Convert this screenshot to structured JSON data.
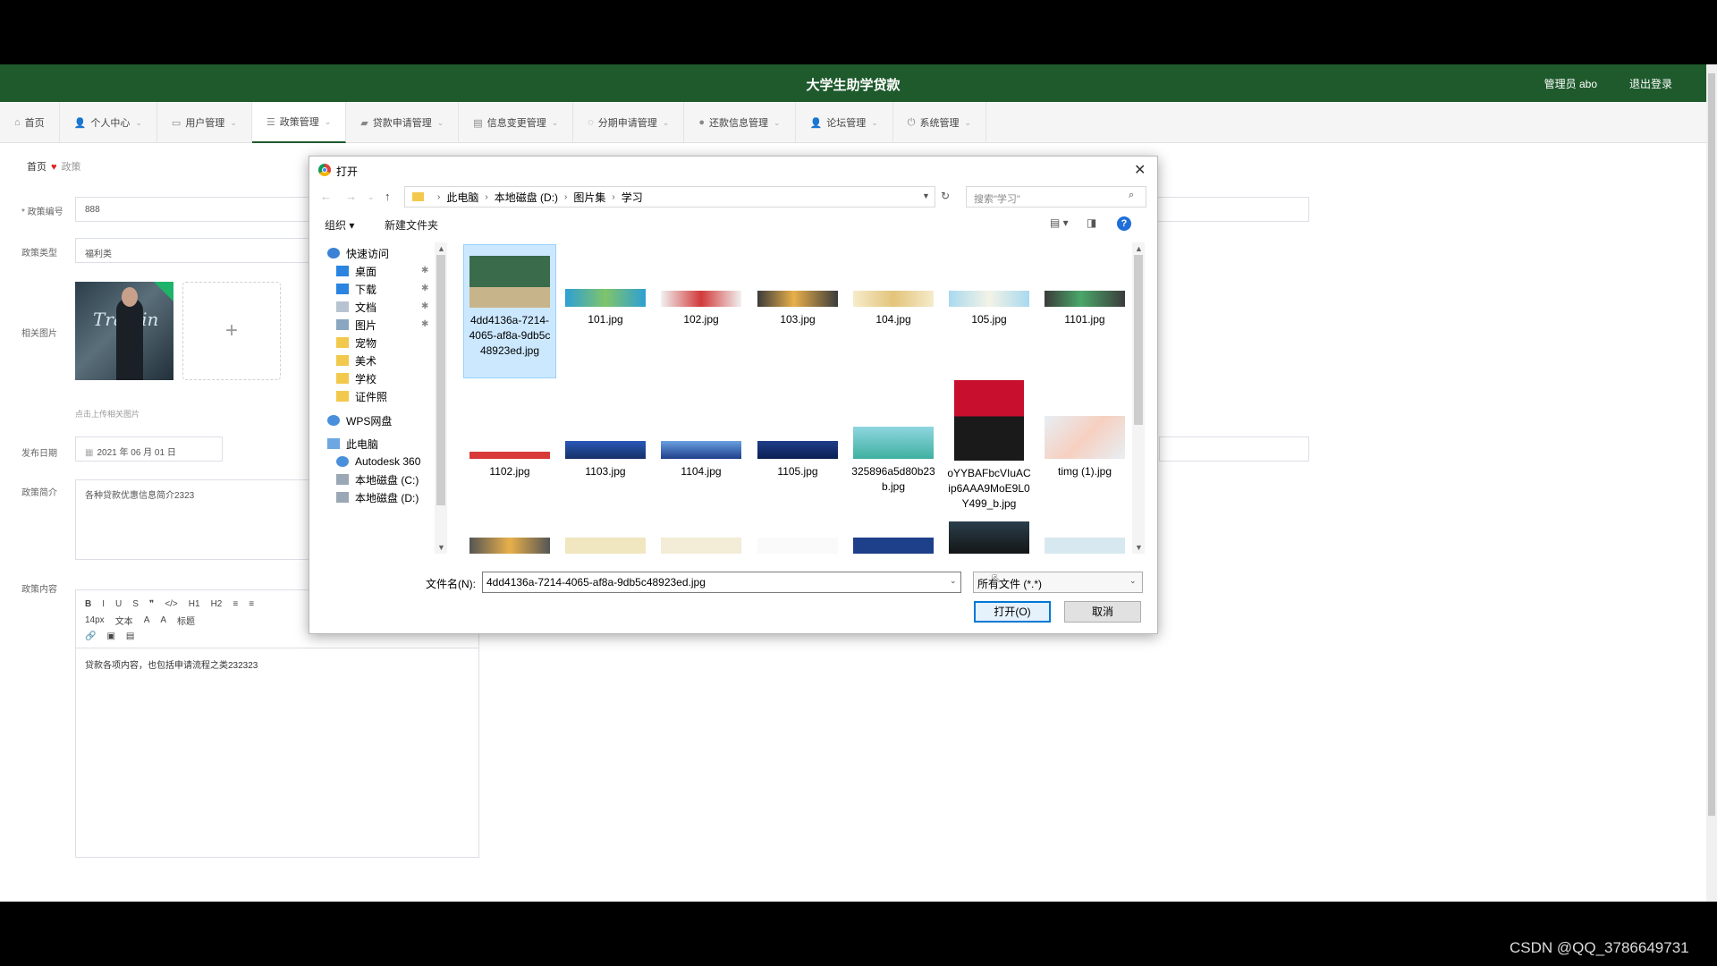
{
  "header": {
    "title": "大学生助学贷款",
    "admin": "管理员 abo",
    "logout": "退出登录"
  },
  "nav": [
    {
      "label": "首页",
      "icon": "home-icon",
      "glyph": "⌂"
    },
    {
      "label": "个人中心",
      "icon": "user-icon",
      "glyph": "👤"
    },
    {
      "label": "用户管理",
      "icon": "chat-icon",
      "glyph": "▭"
    },
    {
      "label": "政策管理",
      "icon": "list-icon",
      "glyph": "☰"
    },
    {
      "label": "贷款申请管理",
      "icon": "briefcase-icon",
      "glyph": "▰"
    },
    {
      "label": "信息变更管理",
      "icon": "database-icon",
      "glyph": "▤"
    },
    {
      "label": "分期申请管理",
      "icon": "bulb-icon",
      "glyph": "◌"
    },
    {
      "label": "还款信息管理",
      "icon": "pin-icon",
      "glyph": "●"
    },
    {
      "label": "论坛管理",
      "icon": "user-icon",
      "glyph": "👤"
    },
    {
      "label": "系统管理",
      "icon": "power-icon",
      "glyph": "⏻"
    }
  ],
  "breadcrumb": {
    "home": "首页",
    "current": "政策"
  },
  "form": {
    "policy_no_label": "* 政策编号",
    "policy_no_value": "888",
    "policy_type_label": "政策类型",
    "policy_type_value": "福利类",
    "image_label": "相关图片",
    "thumb_text": "Trainin",
    "upload_plus": "+",
    "upload_hint": "点击上传相关图片",
    "date_label": "发布日期",
    "date_value": "2021 年 06 月 01 日",
    "intro_label": "政策简介",
    "intro_value": "各种贷款优惠信息简介2323",
    "content_label": "政策内容",
    "toolbar_row1": [
      "B",
      "I",
      "U",
      "S",
      "❞",
      "</>",
      "H1",
      "H2",
      "≡",
      "≡"
    ],
    "toolbar_row2": [
      "14px",
      "文本",
      "A",
      "A",
      "标题"
    ],
    "content_value": "贷款各项内容，也包括申请流程之类232323"
  },
  "dialog": {
    "title": "打开",
    "path": [
      "此电脑",
      "本地磁盘 (D:)",
      "图片集",
      "学习"
    ],
    "search_placeholder": "搜索\"学习\"",
    "organize": "组织 ▾",
    "new_folder": "新建文件夹",
    "help": "?",
    "tree": [
      {
        "label": "快速访问",
        "icon": "star-icon",
        "pinned": false
      },
      {
        "label": "桌面",
        "icon": "desktop-icon",
        "pinned": true
      },
      {
        "label": "下载",
        "icon": "download-icon",
        "pinned": true
      },
      {
        "label": "文档",
        "icon": "document-icon",
        "pinned": true
      },
      {
        "label": "图片",
        "icon": "picture-icon",
        "pinned": true
      },
      {
        "label": "宠物",
        "icon": "folder-icon",
        "pinned": false
      },
      {
        "label": "美术",
        "icon": "folder-icon",
        "pinned": false
      },
      {
        "label": "学校",
        "icon": "folder-icon",
        "pinned": false
      },
      {
        "label": "证件照",
        "icon": "folder-icon",
        "pinned": false
      },
      {
        "label": "WPS网盘",
        "icon": "cloud-icon",
        "pinned": false
      },
      {
        "label": "此电脑",
        "icon": "computer-icon",
        "pinned": false
      },
      {
        "label": "Autodesk 360",
        "icon": "cloud-icon",
        "pinned": false
      },
      {
        "label": "本地磁盘 (C:)",
        "icon": "drive-icon",
        "pinned": false
      },
      {
        "label": "本地磁盘 (D:)",
        "icon": "drive-icon",
        "pinned": false
      }
    ],
    "files": [
      "4dd4136a-7214-4065-af8a-9db5c48923ed.jpg",
      "101.jpg",
      "102.jpg",
      "103.jpg",
      "104.jpg",
      "105.jpg",
      "1101.jpg",
      "1102.jpg",
      "1103.jpg",
      "1104.jpg",
      "1105.jpg",
      "325896a5d80b23b.jpg",
      "oYYBAFbcVIuACip6AAA9MoE9L0Y499_b.jpg",
      "timg (1).jpg"
    ],
    "filename_label": "文件名(N):",
    "filename_value": "4dd4136a-7214-4065-af8a-9db5c48923ed.jpg",
    "filetype_value": "所有文件 (*.*)",
    "open_label": "打开(O)",
    "cancel_label": "取消"
  },
  "watermark": "CSDN @QQ_3786649731"
}
